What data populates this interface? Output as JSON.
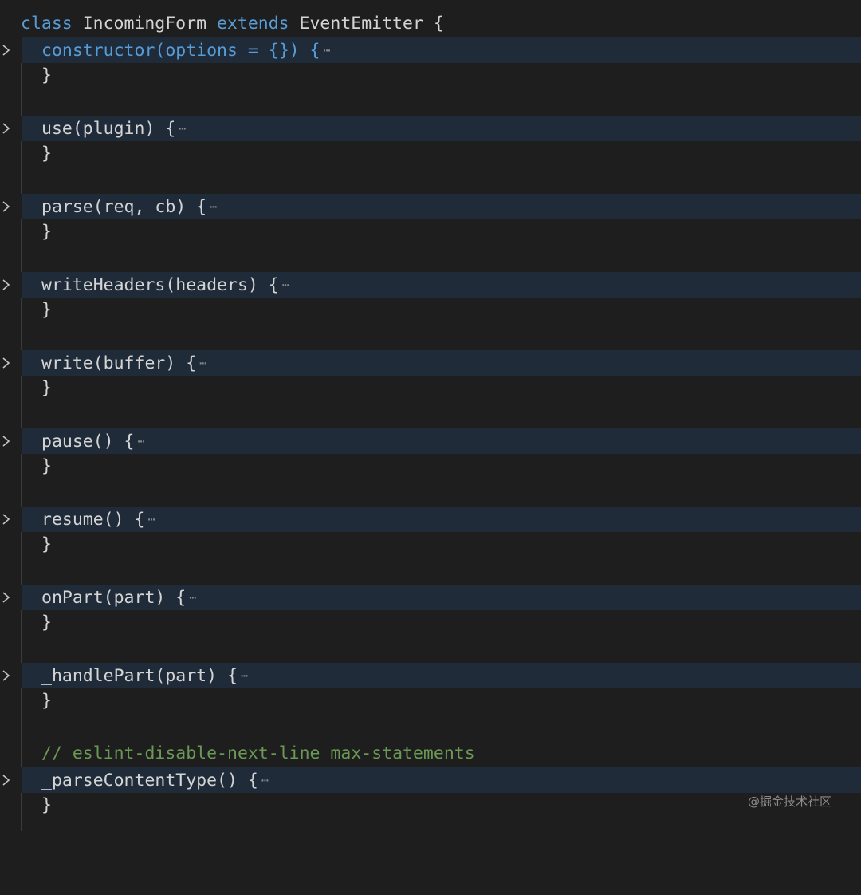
{
  "editor": {
    "class_line": {
      "keyword": "class",
      "name": "IncomingForm",
      "extends_kw": "extends",
      "parent": "EventEmitter",
      "brace": " {"
    },
    "ellipsis": "⋯",
    "close_brace": "}",
    "methods": [
      {
        "signature": "constructor(options = {}) {"
      },
      {
        "signature": "use(plugin) {"
      },
      {
        "signature": "parse(req, cb) {"
      },
      {
        "signature": "writeHeaders(headers) {"
      },
      {
        "signature": "write(buffer) {"
      },
      {
        "signature": "pause() {"
      },
      {
        "signature": "resume() {"
      },
      {
        "signature": "onPart(part) {"
      },
      {
        "signature": "_handlePart(part) {"
      },
      {
        "signature": "_parseContentType() {"
      }
    ],
    "comment": "// eslint-disable-next-line max-statements"
  },
  "watermark": "@掘金技术社区",
  "colors": {
    "background": "#1e1e1e",
    "folded_line_highlight": "#202b3a",
    "keyword": "#569cd6",
    "text": "#d4d4d4",
    "comment": "#6a9955"
  }
}
